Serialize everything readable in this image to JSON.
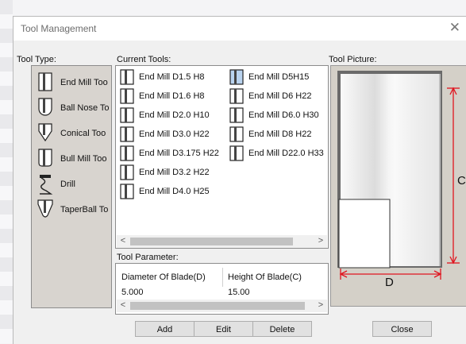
{
  "window": {
    "title": "Tool Management",
    "close_icon": "close-icon"
  },
  "tool_type": {
    "label": "Tool Type:",
    "items": [
      {
        "label": "End Mill Too",
        "icon": "end-mill-icon"
      },
      {
        "label": "Ball Nose To",
        "icon": "ball-nose-icon"
      },
      {
        "label": "Conical Too",
        "icon": "conical-icon"
      },
      {
        "label": "Bull Mill Too",
        "icon": "bull-mill-icon"
      },
      {
        "label": "Drill",
        "icon": "drill-icon"
      },
      {
        "label": "TaperBall To",
        "icon": "taper-ball-icon"
      }
    ]
  },
  "current_tools": {
    "label": "Current Tools:",
    "items": [
      {
        "label": "End Mill D1.5 H8"
      },
      {
        "label": "End Mill D1.6 H8"
      },
      {
        "label": "End Mill D2.0 H10"
      },
      {
        "label": "End Mill D3.0 H22"
      },
      {
        "label": "End Mill D3.175 H22"
      },
      {
        "label": "End Mill D3.2 H22"
      },
      {
        "label": "End Mill D4.0 H25"
      },
      {
        "label": "End Mill D5H15",
        "selected": true
      },
      {
        "label": "End Mill D6 H22"
      },
      {
        "label": "End Mill D6.0 H30"
      },
      {
        "label": "End Mill D8 H22"
      },
      {
        "label": "End Mill D22.0 H33"
      }
    ]
  },
  "tool_parameter": {
    "label": "Tool Parameter:",
    "columns": [
      "Diameter Of Blade(D)",
      "Height Of Blade(C)"
    ],
    "values": [
      "5.000",
      "15.00"
    ]
  },
  "tool_picture": {
    "label": "Tool Picture:",
    "dim_c": "C",
    "dim_d": "D"
  },
  "buttons": {
    "add": "Add",
    "edit": "Edit",
    "delete": "Delete",
    "close": "Close"
  },
  "colors": {
    "dimension_red": "#e0141e",
    "selected_icon": "#b9d3ef"
  }
}
